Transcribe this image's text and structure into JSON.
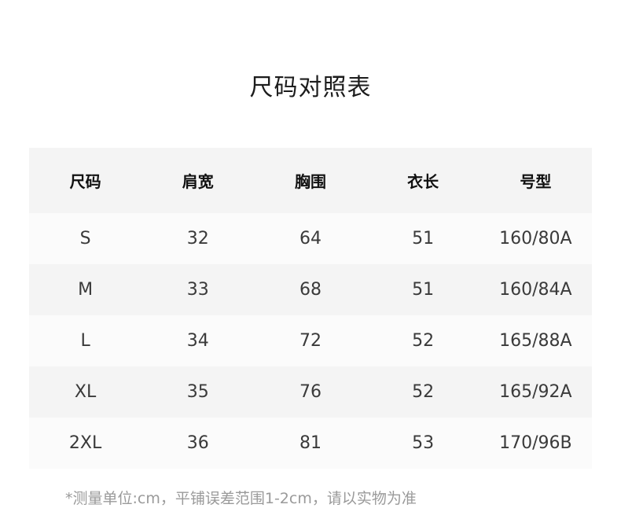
{
  "title": "尺码对照表",
  "table": {
    "headers": [
      "尺码",
      "肩宽",
      "胸围",
      "衣长",
      "号型"
    ],
    "rows": [
      [
        "S",
        "32",
        "64",
        "51",
        "160/80A"
      ],
      [
        "M",
        "33",
        "68",
        "51",
        "160/84A"
      ],
      [
        "L",
        "34",
        "72",
        "52",
        "165/88A"
      ],
      [
        "XL",
        "35",
        "76",
        "52",
        "165/92A"
      ],
      [
        "2XL",
        "36",
        "81",
        "53",
        "170/96B"
      ]
    ]
  },
  "note": "*测量单位:cm，平铺误差范围1-2cm，请以实物为准",
  "colors": {
    "header_bg": "#f4f4f4",
    "row_light": "#fbfbfb",
    "row_dark": "#f4f4f4",
    "note_text": "#9a9a9a"
  }
}
